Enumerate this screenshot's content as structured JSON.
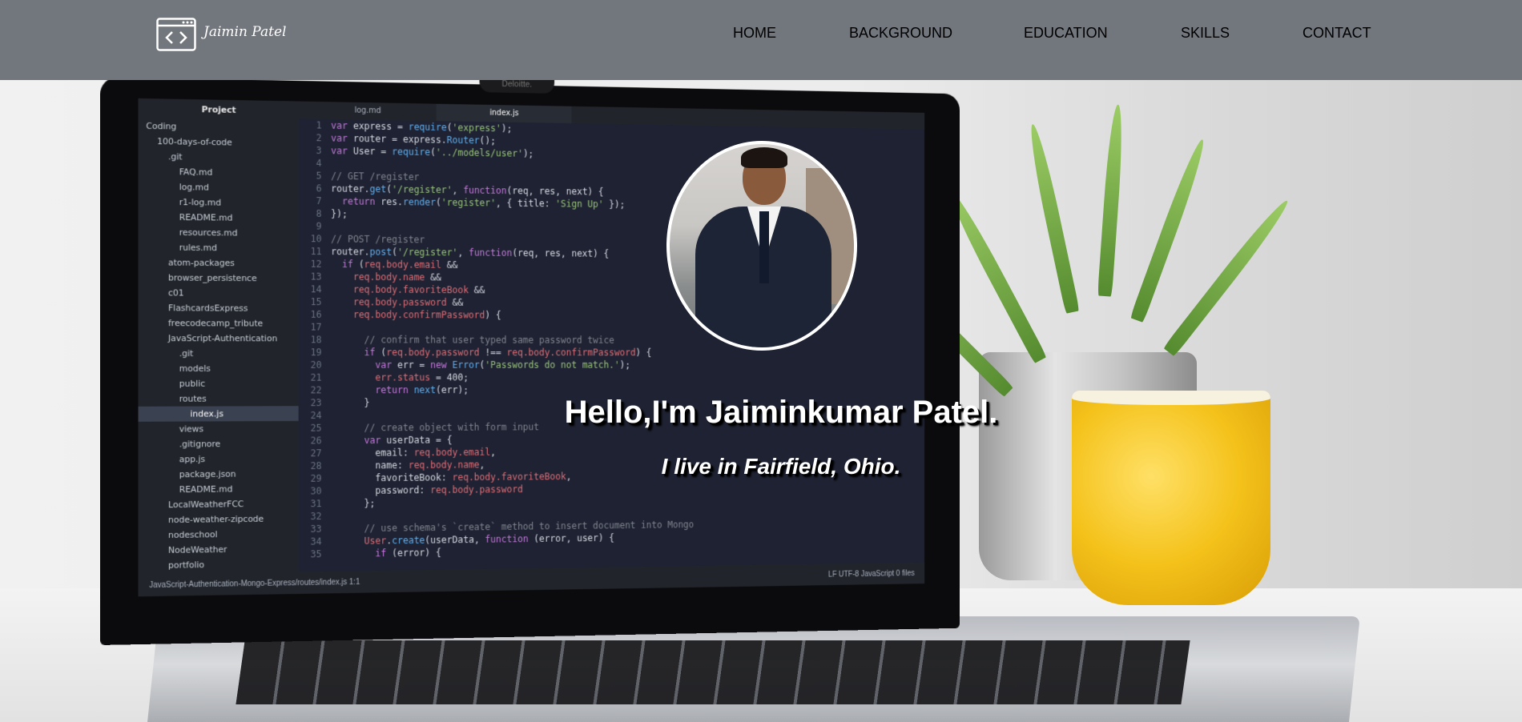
{
  "brand": {
    "name": "Jaimin Patel",
    "logo_icon": "code-window-icon"
  },
  "nav": {
    "items": [
      "HOME",
      "BACKGROUND",
      "EDUCATION",
      "SKILLS",
      "CONTACT"
    ]
  },
  "hero": {
    "greeting": "Hello,I'm Jaiminkumar Patel.",
    "location": "I live in Fairfield, Ohio.",
    "profile_photo": "portrait-photo"
  },
  "background_screen": {
    "project_title": "Project",
    "tabs": [
      "log.md",
      "index.js"
    ],
    "webcam_brand": "Deloitte.",
    "tree": [
      "Coding",
      "100-days-of-code",
      ".git",
      "FAQ.md",
      "log.md",
      "r1-log.md",
      "README.md",
      "resources.md",
      "rules.md",
      "atom-packages",
      "browser_persistence",
      "c01",
      "FlashcardsExpress",
      "freecodecamp_tribute",
      "JavaScript-Authentication",
      ".git",
      "models",
      "public",
      "routes",
      "index.js",
      "views",
      ".gitignore",
      "app.js",
      "package.json",
      "README.md",
      "LocalWeatherFCC",
      "node-weather-zipcode",
      "nodeschool",
      "NodeWeather",
      "portfolio"
    ],
    "status_left": "JavaScript-Authentication-Mongo-Express/routes/index.js   1:1",
    "status_right": "LF   UTF-8   JavaScript   0 files"
  }
}
